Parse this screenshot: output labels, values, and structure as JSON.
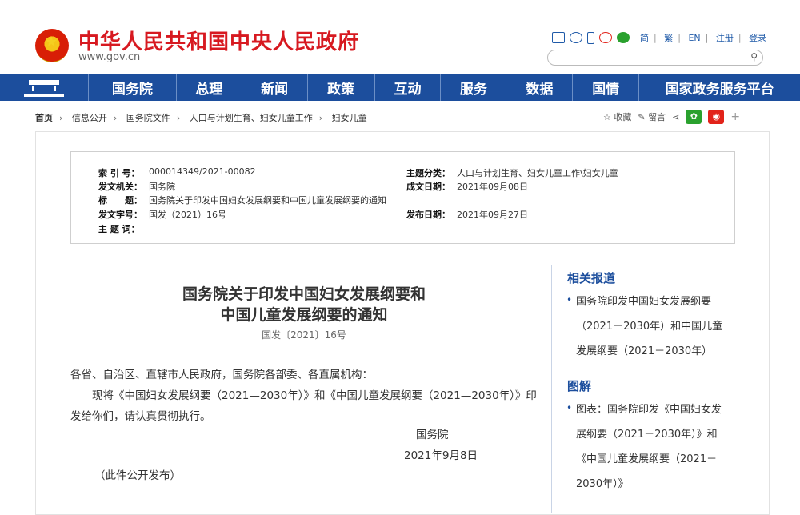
{
  "header": {
    "site_title": "中华人民共和国中央人民政府",
    "site_url": "www.gov.cn",
    "links": [
      "简",
      "繁",
      "EN",
      "注册",
      "登录"
    ]
  },
  "nav": [
    "国务院",
    "总理",
    "新闻",
    "政策",
    "互动",
    "服务",
    "数据",
    "国情",
    "国家政务服务平台"
  ],
  "breadcrumb": [
    "首页",
    "信息公开",
    "国务院文件",
    "人口与计划生育、妇女儿童工作",
    "妇女儿童"
  ],
  "tools": {
    "favorite": "收藏",
    "comment": "留言"
  },
  "meta": {
    "index_label": "索 引 号：",
    "index_value": "000014349/2021-00082",
    "issuer_label": "发文机关：",
    "issuer_value": "国务院",
    "title_label": "标　　题：",
    "title_value": "国务院关于印发中国妇女发展纲要和中国儿童发展纲要的通知",
    "docno_label": "发文字号：",
    "docno_value": "国发（2021）16号",
    "subject_label": "主 题 词：",
    "category_label": "主题分类：",
    "category_value": "人口与计划生育、妇女儿童工作\\妇女儿童",
    "created_label": "成文日期：",
    "created_value": "2021年09月08日",
    "published_label": "发布日期：",
    "published_value": "2021年09月27日"
  },
  "article": {
    "title_line1": "国务院关于印发中国妇女发展纲要和",
    "title_line2": "中国儿童发展纲要的通知",
    "docno": "国发〔2021〕16号",
    "salutation": "各省、自治区、直辖市人民政府，国务院各部委、各直属机构：",
    "body": "现将《中国妇女发展纲要（2021—2030年）》和《中国儿童发展纲要（2021—2030年）》印发给你们，请认真贯彻执行。",
    "signature": "国务院",
    "date": "2021年9月8日",
    "note": "（此件公开发布）"
  },
  "sidebar": {
    "related_title": "相关报道",
    "related_item": "国务院印发中国妇女发展纲要（2021－2030年）和中国儿童发展纲要（2021－2030年）",
    "graphic_title": "图解",
    "graphic_item": "图表：国务院印发《中国妇女发展纲要（2021－2030年）》和《中国儿童发展纲要（2021－2030年）》"
  }
}
